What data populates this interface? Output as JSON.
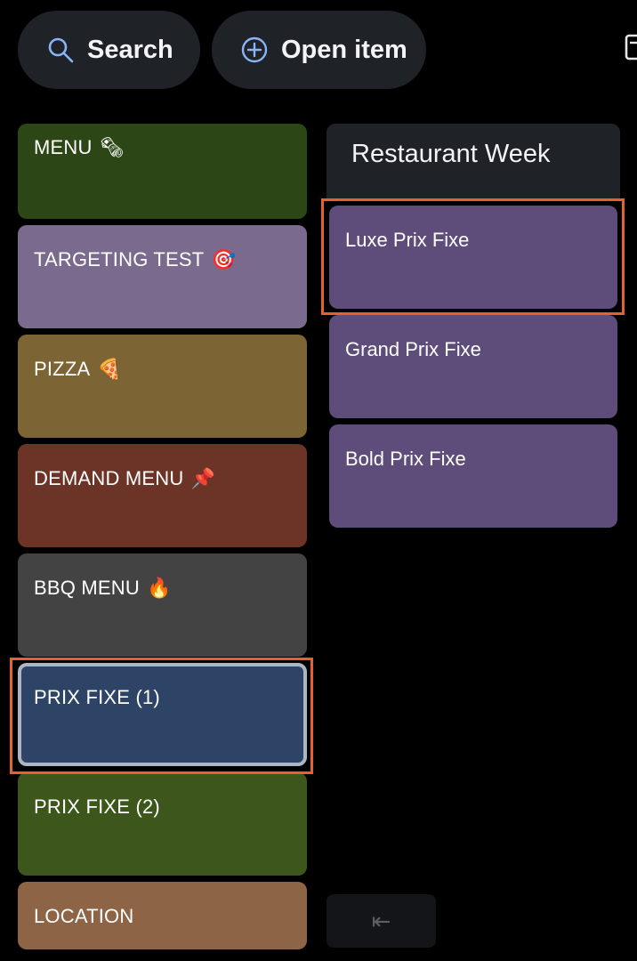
{
  "toolbar": {
    "search_label": "Search",
    "open_item_label": "Open item"
  },
  "categories": [
    {
      "label": "MENU",
      "emoji": "🗞",
      "color": "#2c4715"
    },
    {
      "label": "TARGETING TEST",
      "emoji": "🎯",
      "color": "#7a6a8e"
    },
    {
      "label": "PIZZA",
      "emoji": "🍕",
      "color": "#7c6434"
    },
    {
      "label": "DEMAND MENU",
      "emoji": "📌",
      "color": "#6b3427"
    },
    {
      "label": "BBQ MENU",
      "emoji": "🔥",
      "color": "#434343"
    },
    {
      "label": "PRIX FIXE (1)",
      "emoji": "",
      "color": "#2e4466"
    },
    {
      "label": "PRIX FIXE (2)",
      "emoji": "",
      "color": "#3c561c"
    },
    {
      "label": "LOCATION",
      "emoji": "",
      "color": "#8d6446"
    }
  ],
  "group": {
    "title": "Restaurant Week",
    "items": [
      {
        "label": "Luxe Prix Fixe"
      },
      {
        "label": "Grand Prix Fixe"
      },
      {
        "label": "Bold Prix Fixe"
      }
    ],
    "item_color": "#5e4d7a"
  },
  "back_button": {
    "icon": "arrow-bar-left-icon",
    "glyph": "⇤"
  },
  "colors": {
    "background": "#000000",
    "pill_background": "#1f2328",
    "highlight": "#e8602c",
    "icon_blue": "#8ab4f8"
  }
}
